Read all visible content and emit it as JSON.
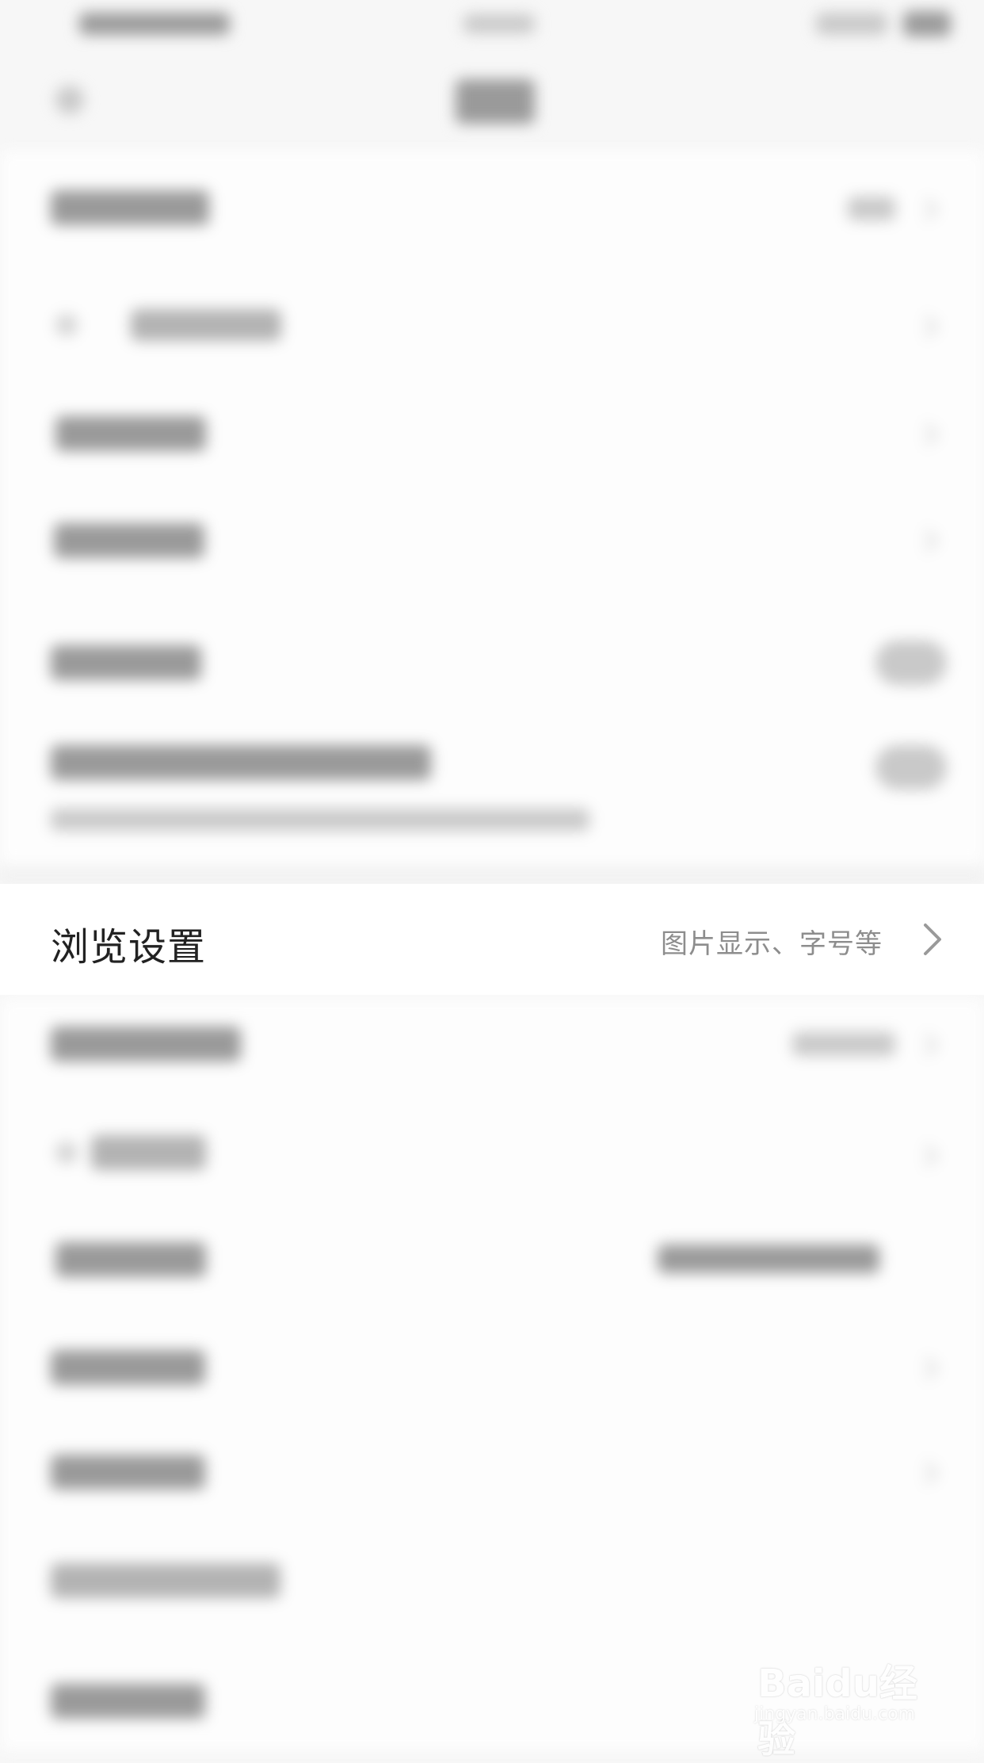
{
  "setting_row": {
    "title": "浏览设置",
    "hint": "图片显示、字号等"
  },
  "watermark": {
    "logo": "Baidu经验",
    "url": "jingyan.baidu.com"
  },
  "icons": {
    "chevron": "chevron-right-icon"
  }
}
